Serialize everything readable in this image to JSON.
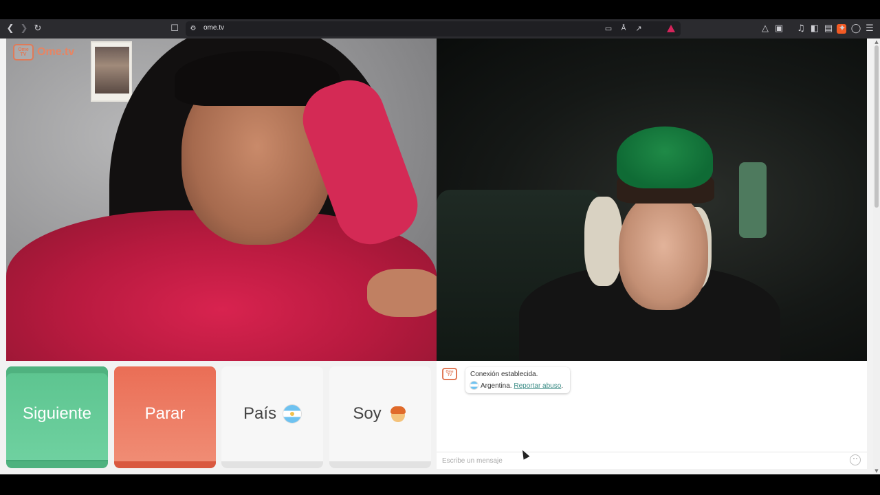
{
  "browser": {
    "url": "ome.tv",
    "toolbar_icons": [
      "back-icon",
      "forward-icon",
      "reload-icon",
      "bookmark-icon",
      "site-settings-icon",
      "cast-icon",
      "translate-icon",
      "share-icon",
      "brave-shields-icon",
      "brave-rewards-icon",
      "extensions-icon",
      "screenshot-icon",
      "media-icon",
      "sidebar-icon",
      "wallet-icon",
      "leo-ai-icon",
      "vpn-icon",
      "menu-icon"
    ]
  },
  "site": {
    "logo_text": "Ome.tv",
    "logo_badge": "Ome TV"
  },
  "controls": {
    "next_label": "Siguiente",
    "stop_label": "Parar",
    "country_label": "País",
    "soy_label": "Soy"
  },
  "chat": {
    "status_line": "Conexión establecida.",
    "country_name": "Argentina.",
    "report_link": "Reportar abuso",
    "report_suffix": ".",
    "input_placeholder": "Escribe un mensaje"
  },
  "colors": {
    "next_button": "#6fd1a0",
    "stop_button": "#f08c74",
    "logo_accent": "#e07a58",
    "link": "#3b8c86"
  }
}
